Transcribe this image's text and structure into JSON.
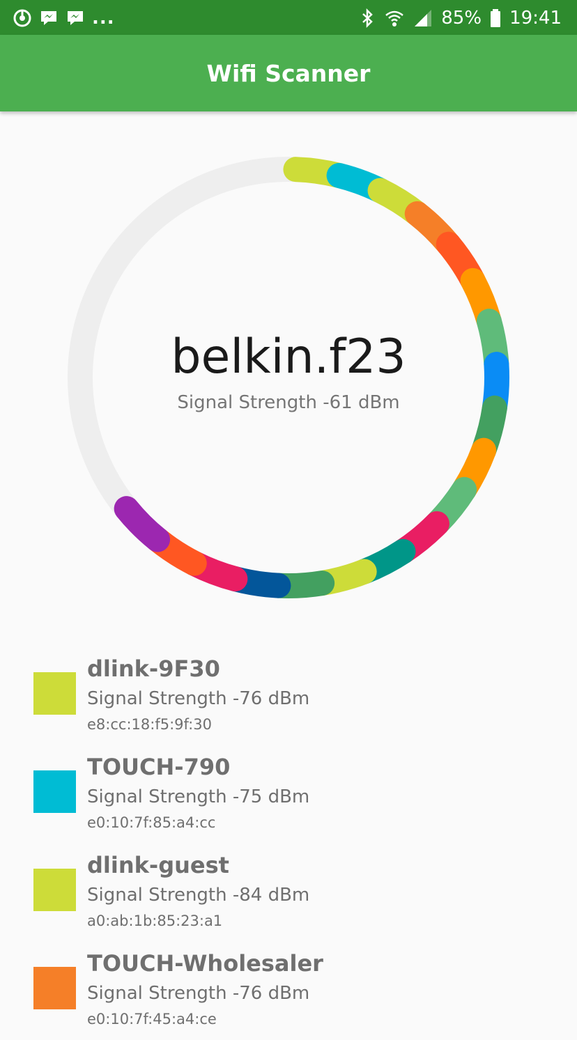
{
  "status_bar": {
    "left_icons": [
      "app-icon",
      "messenger-icon",
      "messenger-icon"
    ],
    "overflow": "...",
    "battery": "85%",
    "time": "19:41"
  },
  "app_bar": {
    "title": "Wifi Scanner"
  },
  "selected": {
    "name": "belkin.f23",
    "signal": "Signal Strength -61 dBm"
  },
  "ring": {
    "track_color": "#eeeeee",
    "segment_colors": [
      "#cddc39",
      "#00bcd4",
      "#cddc39",
      "#f57f28",
      "#ff5722",
      "#ff9800",
      "#5fbb7a",
      "#0a8cf5",
      "#43a060",
      "#ff9800",
      "#5fbb7a",
      "#e91e63",
      "#009688",
      "#cddc39",
      "#43a060",
      "#03569a",
      "#e91e63",
      "#ff5722",
      "#9c27b0"
    ]
  },
  "networks": [
    {
      "name": "dlink-9F30",
      "signal": "Signal Strength -76 dBm",
      "mac": "e8:cc:18:f5:9f:30",
      "color": "#cddc39"
    },
    {
      "name": "TOUCH-790",
      "signal": "Signal Strength -75 dBm",
      "mac": "e0:10:7f:85:a4:cc",
      "color": "#00bcd4"
    },
    {
      "name": "dlink-guest",
      "signal": "Signal Strength -84 dBm",
      "mac": "a0:ab:1b:85:23:a1",
      "color": "#cddc39"
    },
    {
      "name": "TOUCH-Wholesaler",
      "signal": "Signal Strength -76 dBm",
      "mac": "e0:10:7f:45:a4:ce",
      "color": "#f57f28"
    }
  ]
}
